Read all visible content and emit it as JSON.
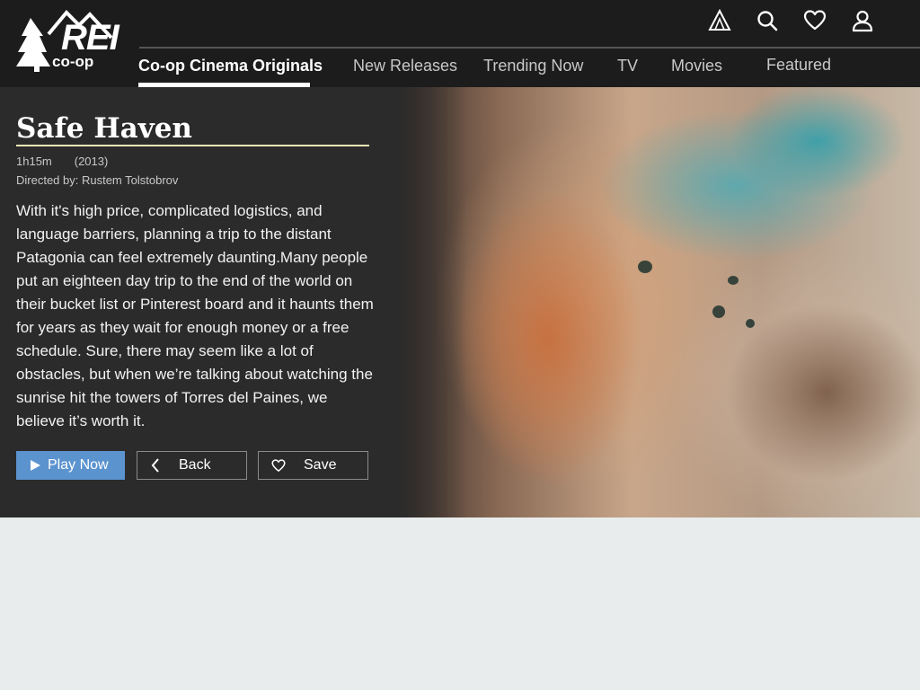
{
  "brand": {
    "logo_main": "REI",
    "logo_sub": "co-op"
  },
  "header_icons": [
    {
      "name": "camp-tent-icon"
    },
    {
      "name": "search-icon"
    },
    {
      "name": "heart-icon"
    },
    {
      "name": "user-icon"
    }
  ],
  "nav": {
    "items": [
      {
        "label": "Co-op Cinema Originals",
        "active": true
      },
      {
        "label": "New Releases",
        "active": false
      },
      {
        "label": "Trending Now",
        "active": false
      },
      {
        "label": "TV",
        "active": false
      },
      {
        "label": "Movies",
        "active": false
      },
      {
        "label": "Featured",
        "active": false
      }
    ]
  },
  "movie": {
    "title": "Safe Haven",
    "runtime": "1h15m",
    "year": "(2013)",
    "director": "Directed by: Rustem Tolstobrov",
    "description": "With it's high price, complicated logistics, and language barriers, planning a trip to the distant Patagonia can feel extremely daunting.Many people put an eighteen day trip to the end of the world on their bucket list or Pinterest board and it haunts them for years as they wait for enough money or a free schedule. Sure, there may seem like a lot of obstacles, but when we’re talking about watching the sunrise hit the towers of Torres del Paines, we believe it’s worth it."
  },
  "actions": {
    "play_label": "Play Now",
    "back_label": "Back",
    "save_label": "Save"
  },
  "colors": {
    "header_bg": "#1c1c1c",
    "panel_bg": "#2b2b2b",
    "accent_play": "#5b93cf",
    "title_rule": "#efe6b8",
    "page_bg": "#e9ecec"
  }
}
